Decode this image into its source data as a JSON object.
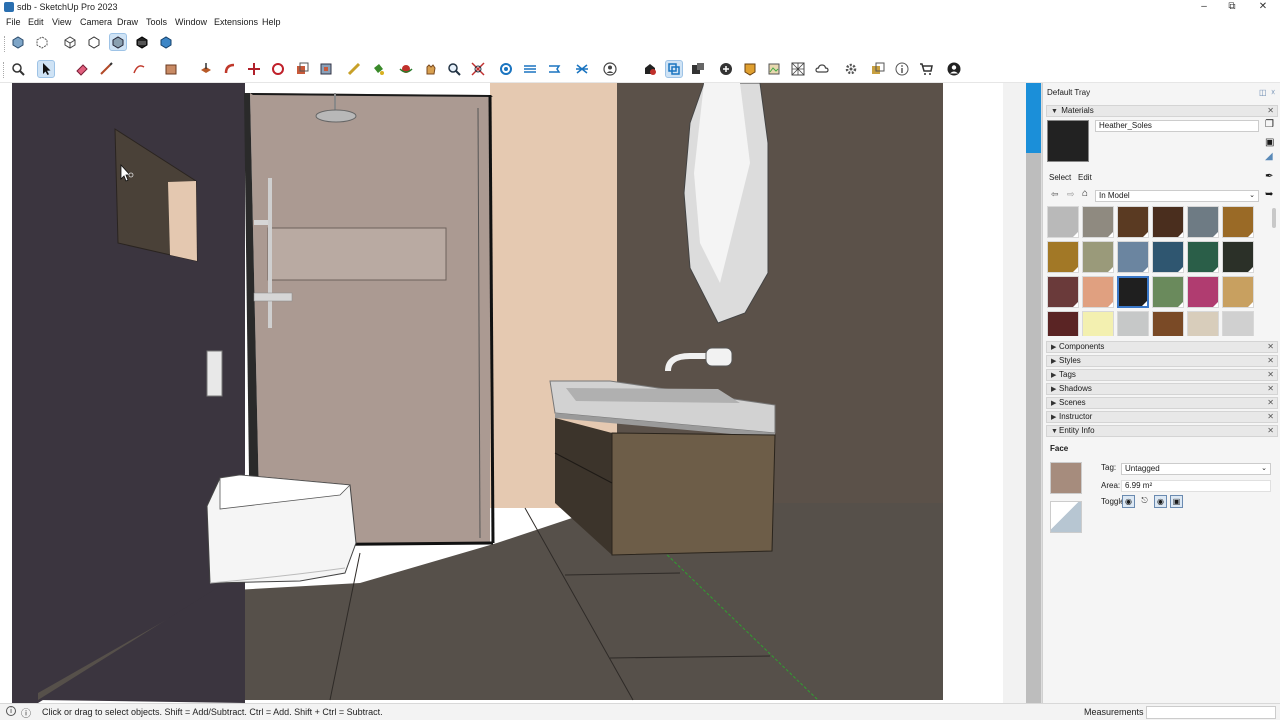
{
  "window": {
    "title": "sdb - SketchUp Pro 2023",
    "minimize_icon": "minimize-icon",
    "maximize_icon": "restore-icon",
    "close_icon": "close-icon"
  },
  "menu": {
    "items": [
      "File",
      "Edit",
      "View",
      "Camera",
      "Draw",
      "Tools",
      "Window",
      "Extensions",
      "Help"
    ]
  },
  "toolbar_top": {
    "icons": [
      "xray-icon",
      "back-edges-icon",
      "wireframe-icon",
      "hidden-line-icon",
      "shaded-icon",
      "shaded-textures-icon",
      "monochrome-icon"
    ],
    "active_index": 4
  },
  "toolbar_main": {
    "icons": [
      "search-icon",
      "select-icon",
      "eraser-icon",
      "line-icon",
      "arc-icon",
      "shape-icon",
      "push-pull-icon",
      "follow-me-icon",
      "move-icon",
      "rotate-icon",
      "scale-icon",
      "tape-measure-icon",
      "paint-bucket-icon",
      "orbit-icon",
      "pan-icon",
      "zoom-icon",
      "zoom-extents-icon",
      "section-plane-icon",
      "section-fill-icon",
      "section-cuts-icon",
      "display-sections-icon",
      "user-icon",
      "warehouse-icon",
      "extension-warehouse-icon",
      "layout-icon",
      "add-location-icon",
      "geo-location-icon",
      "photo-texture-icon",
      "trimble-connect-icon",
      "cloud-icon",
      "extension-manager-icon",
      "solid-tools-icon",
      "info-icon",
      "cart-icon",
      "account-icon"
    ]
  },
  "tray": {
    "title": "Default Tray",
    "materials": {
      "panel_title": "Materials",
      "current_material": "Heather_Soles",
      "tab_select": "Select",
      "tab_edit": "Edit",
      "collection": "In Model",
      "swatches": [
        "#b9b9b9",
        "#8f8a80",
        "#5a3a22",
        "#4a2e1e",
        "#6e7b84",
        "#9a6a26",
        "#a27826",
        "#9a9a7a",
        "#6b85a0",
        "#2f5670",
        "#2a5e48",
        "#2b3028",
        "#6a3a3a",
        "#e0a080",
        "#1f1f1f",
        "#6a8a5c",
        "#b03c70",
        "#c8a060",
        "#5a2424",
        "#f3f0b0",
        "#c6c8c8",
        "#7a4a26",
        "#d8cdbb",
        "#d0d0d0"
      ],
      "selected_index": 14,
      "current_color": "#222222"
    },
    "panels": [
      "Components",
      "Styles",
      "Tags",
      "Shadows",
      "Scenes",
      "Instructor",
      "Entity Info"
    ],
    "entity_info": {
      "type": "Face",
      "tag_label": "Tag:",
      "tag_value": "Untagged",
      "area_label": "Area:",
      "area_value": "6.99 m²",
      "toggles_label": "Toggles:",
      "front_color": "#a68c7d",
      "back_color": "#bcc8d2"
    }
  },
  "status": {
    "message": "Click or drag to select objects. Shift = Add/Subtract. Ctrl = Add. Shift + Ctrl = Subtract.",
    "measurements_label": "Measurements",
    "measurements_value": ""
  },
  "scene": {
    "colors": {
      "dark_wall": "#3c3640",
      "floor": "#57504a",
      "wall_brown": "#5a5048",
      "peach": "#e4c8b0",
      "shower_glass": "#a89890",
      "cabinet": "#6c5c48",
      "basin": "#c8c8c8",
      "blue_stripe": "#1b8fd9"
    }
  }
}
